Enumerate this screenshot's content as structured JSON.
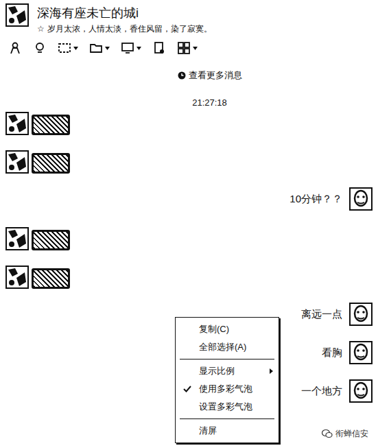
{
  "window": {
    "title": "深海有座未亡的城i",
    "status_mark": "☆",
    "status": "岁月太浓，人情太淡，香住风留，染了寂寞。"
  },
  "toolbar": [
    {
      "dropdown": false
    },
    {
      "dropdown": false
    },
    {
      "dropdown": true
    },
    {
      "dropdown": true
    },
    {
      "dropdown": true
    },
    {
      "dropdown": false
    },
    {
      "dropdown": true
    }
  ],
  "history_link": "查看更多消息",
  "timestamp": "21:27:18",
  "messages": [
    {
      "side": "left",
      "kind": "sticker",
      "text": ""
    },
    {
      "side": "left",
      "kind": "sticker",
      "text": ""
    },
    {
      "side": "right",
      "kind": "text",
      "text": "10分钟？？"
    },
    {
      "side": "left",
      "kind": "sticker",
      "text": ""
    },
    {
      "side": "left",
      "kind": "sticker",
      "text": ""
    },
    {
      "side": "right",
      "kind": "text",
      "text": "离远一点"
    },
    {
      "side": "right",
      "kind": "text",
      "text": "看胸"
    },
    {
      "side": "right",
      "kind": "text",
      "text": "一个地方"
    }
  ],
  "context_menu": {
    "items": [
      {
        "kind": "item",
        "label": "复制(C)",
        "checked": false,
        "submenu": false
      },
      {
        "kind": "item",
        "label": "全部选择(A)",
        "checked": false,
        "submenu": false
      },
      {
        "kind": "separator",
        "label": "",
        "checked": false,
        "submenu": false
      },
      {
        "kind": "item",
        "label": "显示比例",
        "checked": false,
        "submenu": true
      },
      {
        "kind": "item",
        "label": "使用多彩气泡",
        "checked": true,
        "submenu": false
      },
      {
        "kind": "item",
        "label": "设置多彩气泡",
        "checked": false,
        "submenu": false
      },
      {
        "kind": "separator",
        "label": "",
        "checked": false,
        "submenu": false
      },
      {
        "kind": "item",
        "label": "清屏",
        "checked": false,
        "submenu": false
      }
    ]
  },
  "watermark": "衔蝉信安"
}
